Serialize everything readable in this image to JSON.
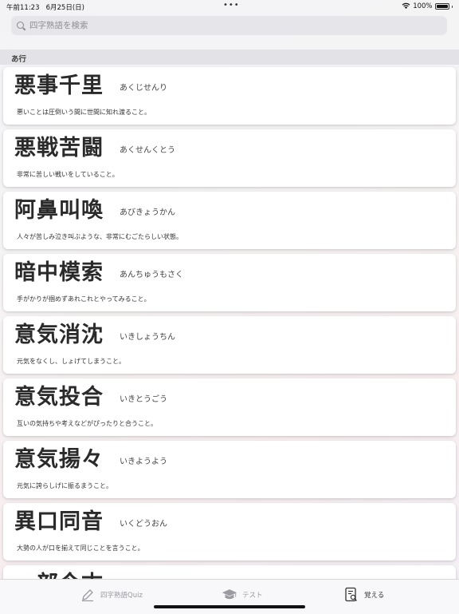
{
  "status": {
    "time": "午前11:23",
    "date": "6月25日(日)",
    "battery": "100%"
  },
  "search": {
    "placeholder": "四字熟語を検索"
  },
  "section": {
    "title": "あ行"
  },
  "entries": [
    {
      "kanji": "悪事千里",
      "reading": "あくじせんり",
      "meaning": "悪いことは圧倒いう間に世間に知れ渡ること。"
    },
    {
      "kanji": "悪戦苦闘",
      "reading": "あくせんくとう",
      "meaning": "非常に苦しい戦いをしていること。"
    },
    {
      "kanji": "阿鼻叫喚",
      "reading": "あびきょうかん",
      "meaning": "人々が苦しみ泣き叫ぶような、非常にむごたらしい状態。"
    },
    {
      "kanji": "暗中模索",
      "reading": "あんちゅうもさく",
      "meaning": "手がかりが掴めずあれこれとやってみること。"
    },
    {
      "kanji": "意気消沈",
      "reading": "いきしょうちん",
      "meaning": "元気をなくし、しょげてしまうこと。"
    },
    {
      "kanji": "意気投合",
      "reading": "いきとうごう",
      "meaning": "互いの気持ちや考えなどがぴったりと合うこと。"
    },
    {
      "kanji": "意気揚々",
      "reading": "いきようよう",
      "meaning": "元気に誇らしげに振るまうこと。"
    },
    {
      "kanji": "異口同音",
      "reading": "いくどうおん",
      "meaning": "大勢の人が口を揃えて同じことを言うこと。"
    },
    {
      "kanji": "一部今古",
      "reading": "",
      "meaning": ""
    }
  ],
  "tabs": [
    {
      "label": "四字熟語Quiz",
      "icon": "pencil-icon"
    },
    {
      "label": "テスト",
      "icon": "graduation-cap-icon"
    },
    {
      "label": "覚える",
      "icon": "document-search-icon"
    }
  ]
}
